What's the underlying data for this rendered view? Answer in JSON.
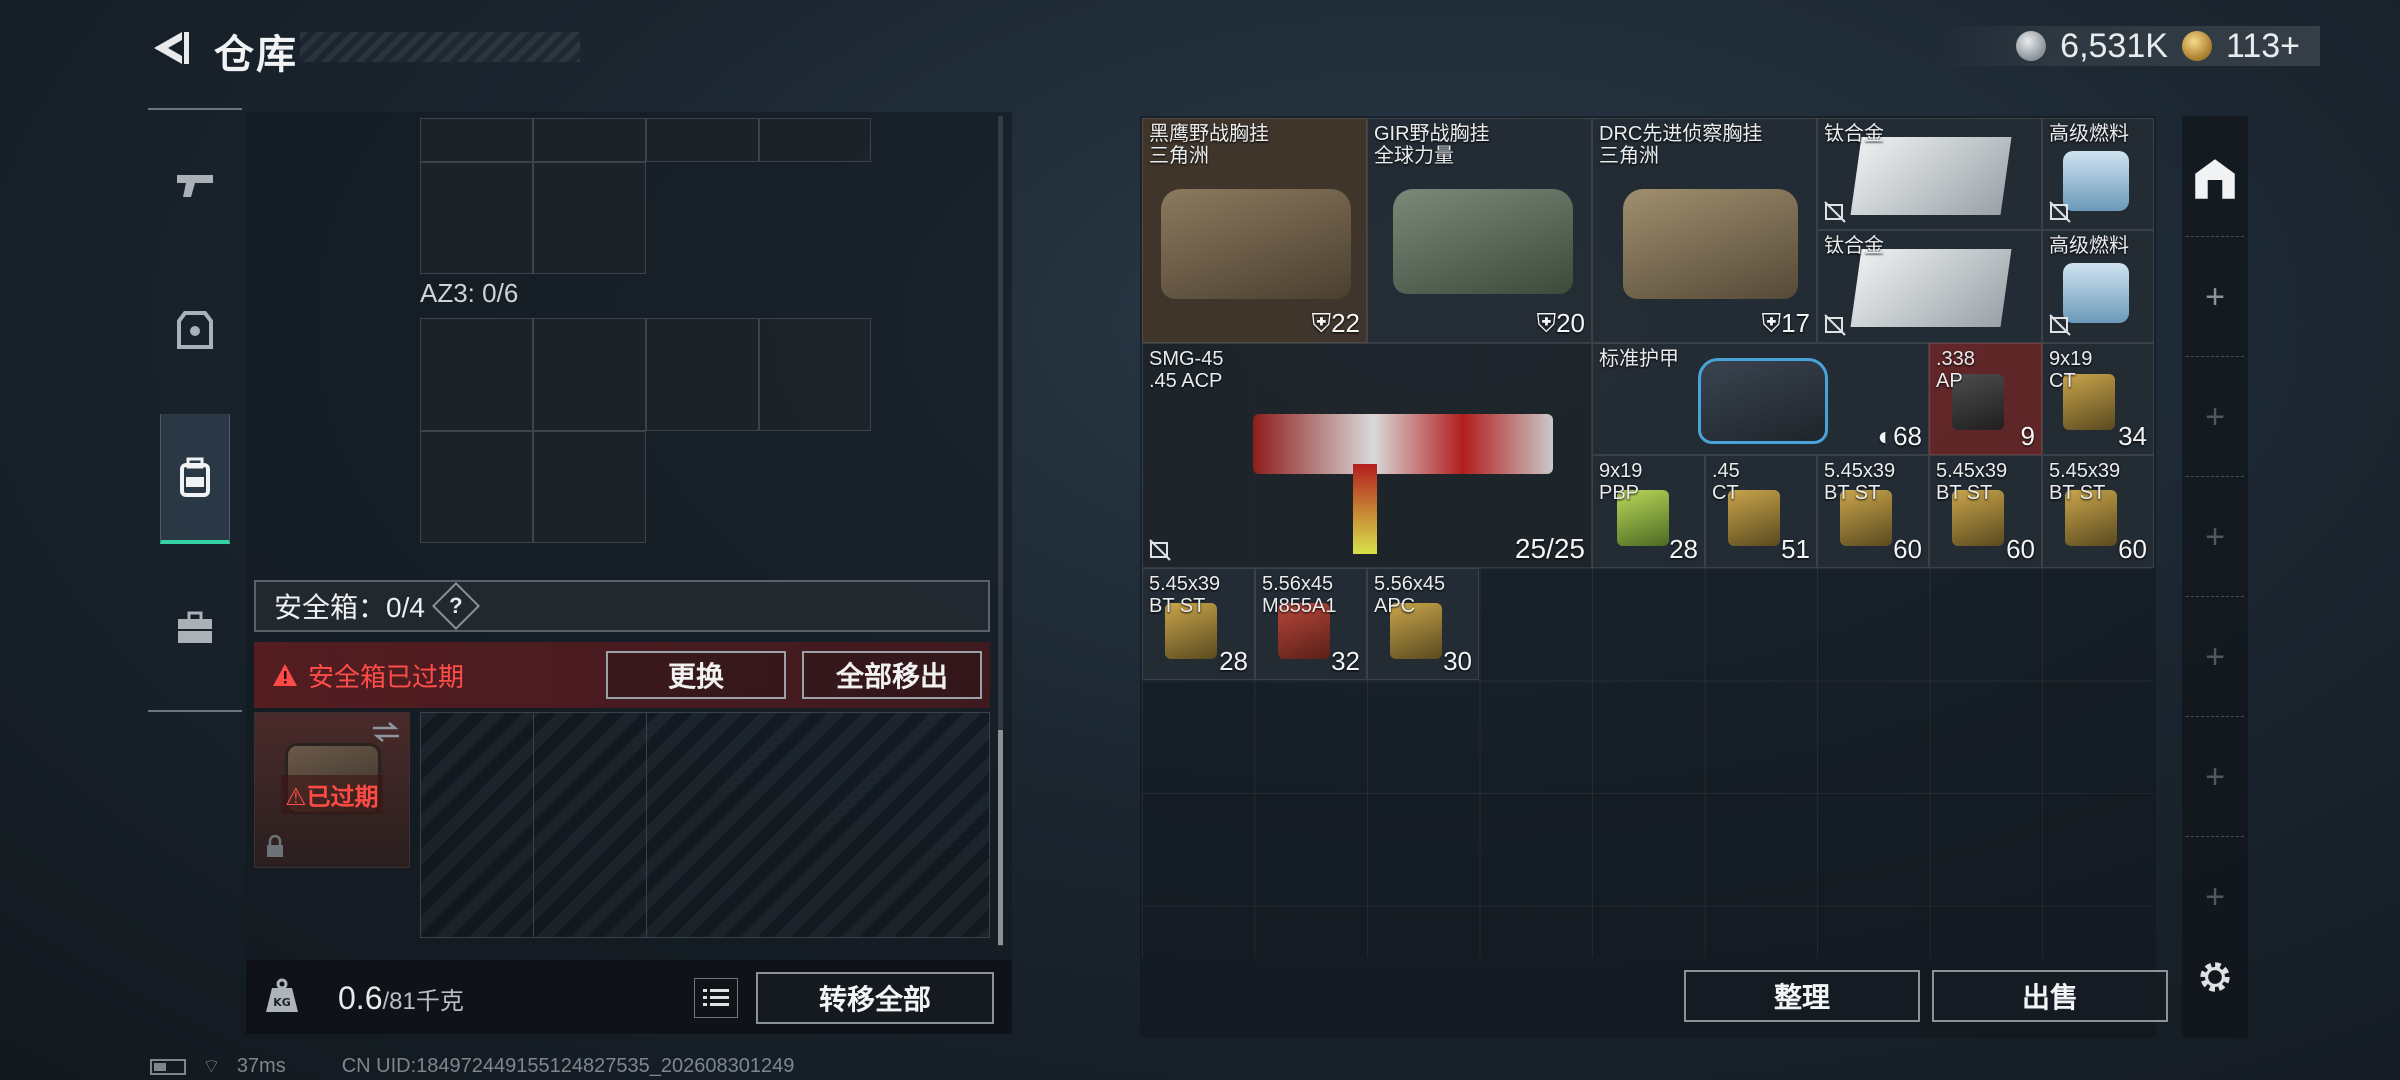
{
  "header": {
    "title": "仓库",
    "currency": [
      {
        "icon": "silver-coin-icon",
        "value": "6,531K"
      },
      {
        "icon": "gold-coin-icon",
        "value": "113+"
      }
    ]
  },
  "tabs": [
    {
      "name": "weapons",
      "icon": "pistol-icon"
    },
    {
      "name": "armor",
      "icon": "vest-icon"
    },
    {
      "name": "backpack",
      "icon": "backpack-icon",
      "active": true
    },
    {
      "name": "case",
      "icon": "briefcase-icon"
    }
  ],
  "left": {
    "az3_label": "AZ3: 0/6",
    "safe_box": {
      "label": "安全箱：0/4",
      "help": "?",
      "warning": "安全箱已过期",
      "replace_button": "更换",
      "move_all_out_button": "全部移出",
      "item_status": "已过期"
    },
    "weight": {
      "current": "0.6",
      "max": "/81千克"
    },
    "transfer_all_button": "转移全部"
  },
  "stash": {
    "items": [
      {
        "name": "黑鹰野战胸挂\n三角洲",
        "count": "22"
      },
      {
        "name": "GIR野战胸挂\n全球力量",
        "count": "20"
      },
      {
        "name": "DRC先进侦察胸挂\n三角洲",
        "count": "17"
      },
      {
        "name": "钛合金",
        "count": ""
      },
      {
        "name": "高级燃料",
        "count": ""
      },
      {
        "name": "钛合金",
        "count": ""
      },
      {
        "name": "高级燃料",
        "count": ""
      },
      {
        "name": "SMG-45\n.45 ACP",
        "count": "25/25"
      },
      {
        "name": "标准护甲",
        "count": "68"
      },
      {
        "name": ".338\nAP",
        "count": "9"
      },
      {
        "name": "9x19\nCT",
        "count": "34"
      },
      {
        "name": "9x19\nPBP",
        "count": "28"
      },
      {
        "name": ".45\nCT",
        "count": "51"
      },
      {
        "name": "5.45x39\nBT ST",
        "count": "60"
      },
      {
        "name": "5.45x39\nBT ST",
        "count": "60"
      },
      {
        "name": "5.45x39\nBT ST",
        "count": "60"
      },
      {
        "name": "5.45x39\nBT ST",
        "count": "28"
      },
      {
        "name": "5.56x45\nM855A1",
        "count": "32"
      },
      {
        "name": "5.56x45\nAPC",
        "count": "30"
      }
    ],
    "organize_button": "整理",
    "sell_button": "出售"
  },
  "status_bar": {
    "ping": "37ms",
    "uid": "CN UID:18497244915512482753​5_202608301249"
  }
}
